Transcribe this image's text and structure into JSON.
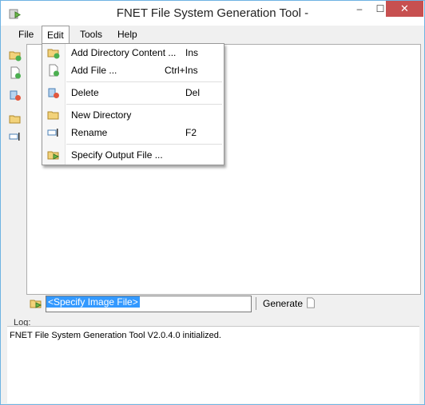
{
  "window": {
    "title": "FNET File System Generation Tool -",
    "caption": {
      "minimize": "–",
      "maximize": "☐",
      "close": "✕"
    }
  },
  "menubar": {
    "items": [
      "File",
      "Edit",
      "Tools",
      "Help"
    ],
    "open": "Edit"
  },
  "edit_menu": {
    "items": [
      {
        "label": "Add Directory Content ...",
        "shortcut": "Ins",
        "icon": "folder-add-icon"
      },
      {
        "label": "Add File ...",
        "shortcut": "Ctrl+Ins",
        "icon": "file-add-icon"
      },
      {
        "label": "Delete",
        "shortcut": "Del",
        "icon": "delete-icon"
      },
      {
        "label": "New Directory",
        "shortcut": "",
        "icon": "new-folder-icon"
      },
      {
        "label": "Rename",
        "shortcut": "F2",
        "icon": "rename-icon"
      },
      {
        "label": "Specify Output File ...",
        "shortcut": "",
        "icon": "output-file-icon"
      }
    ]
  },
  "bottom": {
    "image_file": "<Specify Image File>",
    "generate_label": "Generate"
  },
  "log": {
    "label": "Log:",
    "text": "FNET File System Generation Tool V2.0.4.0 initialized."
  },
  "colors": {
    "accent_border": "#6fb3e2",
    "close_button": "#c75050",
    "selection": "#3399ff"
  }
}
